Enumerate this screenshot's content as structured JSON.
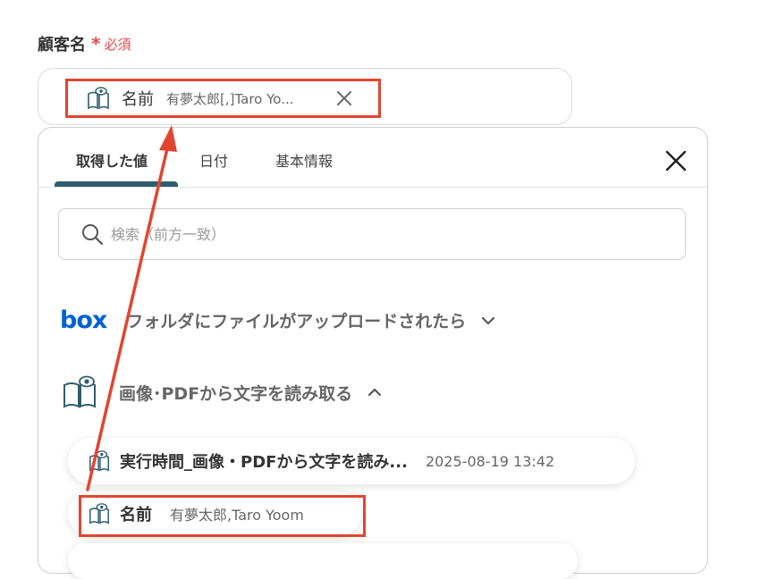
{
  "field": {
    "label": "顧客名",
    "required_star": "*",
    "required_text": "必須"
  },
  "chip": {
    "name": "名前",
    "value": "有夢太郎[,]Taro Yo..."
  },
  "tabs": [
    {
      "label": "取得した値",
      "active": true
    },
    {
      "label": "日付",
      "active": false
    },
    {
      "label": "基本情報",
      "active": false
    }
  ],
  "search": {
    "placeholder": "検索（前方一致）"
  },
  "groups": [
    {
      "title": "フォルダにファイルがアップロードされたら",
      "icon": "box-logo",
      "expanded": false
    },
    {
      "title": "画像･PDFから文字を読み取る",
      "icon": "book-eye-icon",
      "expanded": true
    }
  ],
  "items": [
    {
      "name": "実行時間_画像・PDFから文字を読み...",
      "value": "2025-08-19 13:42"
    },
    {
      "name": "名前",
      "value": "有夢太郎,Taro Yoom"
    }
  ],
  "brand": {
    "box_logo": "box",
    "box_color": "#0061d5",
    "accent": "#2f5d6e",
    "highlight": "#e2452f",
    "required": "#e8464a"
  }
}
